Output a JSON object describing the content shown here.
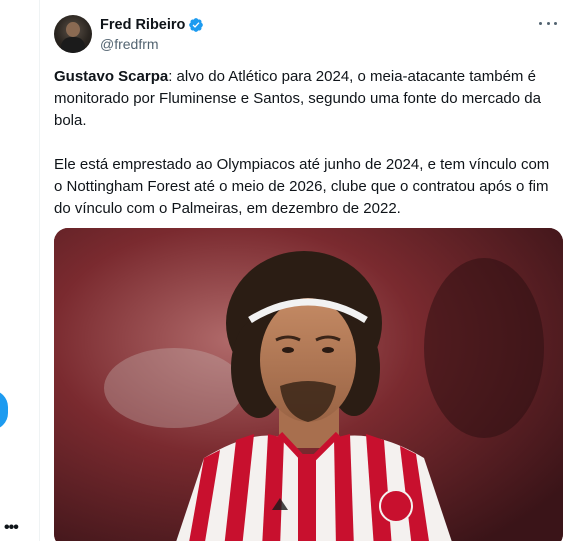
{
  "tweet": {
    "author": {
      "name": "Fred Ribeiro",
      "handle": "@fredfrm",
      "verified": true
    },
    "text": {
      "p1_bold": "Gustavo Scarpa",
      "p1_rest": ": alvo do Atlético para 2024, o meia-atacante também é monitorado por Fluminense e Santos, segundo uma fonte do mercado da bola.",
      "p2": "Ele está emprestado ao Olympiacos até junho de 2024, e tem vínculo com o Nottingham Forest até o meio de 2026, clube que o contratou após o fim do vínculo com o Palmeiras, em dezembro de 2022."
    }
  },
  "colors": {
    "accent": "#1d9bf0",
    "text": "#0f1419",
    "secondary": "#536471",
    "jersey_red": "#c8102e"
  },
  "icons": [
    "verified-badge-icon",
    "more-options-icon"
  ]
}
